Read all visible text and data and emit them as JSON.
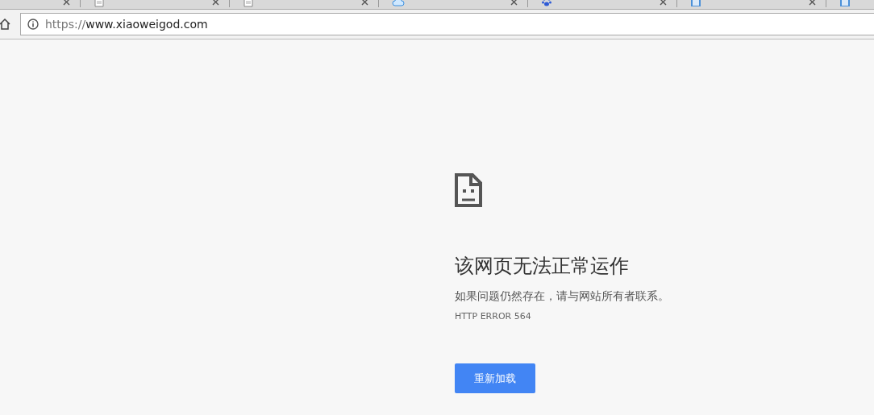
{
  "tabs": [
    {
      "selected": false
    },
    {
      "kind": "page",
      "selected": false
    },
    {
      "kind": "page",
      "selected": false
    },
    {
      "kind": "cloud",
      "selected": false
    },
    {
      "kind": "paw",
      "selected": false
    },
    {
      "kind": "doc",
      "selected": false
    },
    {
      "kind": "doc",
      "selected": false
    }
  ],
  "address_bar": {
    "scheme": "https://",
    "host": "www.xiaoweigod.com"
  },
  "error_page": {
    "title": "该网页无法正常运作",
    "message": "如果问题仍然存在，请与网站所有者联系。",
    "code": "HTTP ERROR 564",
    "reload_button": "重新加载"
  }
}
